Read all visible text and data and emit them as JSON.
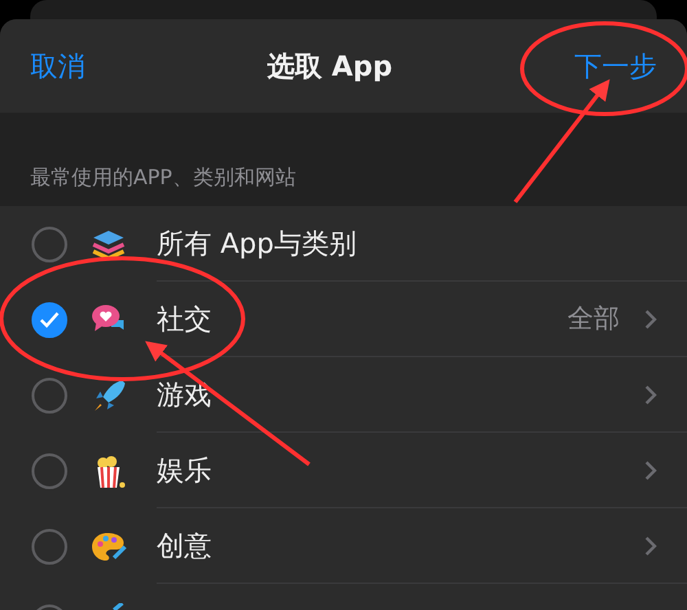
{
  "header": {
    "cancel": "取消",
    "title": "选取 App",
    "next": "下一步"
  },
  "section_title": "最常使用的APP、类别和网站",
  "rows": [
    {
      "kind": "layers",
      "label": "所有 App与类别",
      "checked": false,
      "chevron": false
    },
    {
      "kind": "chat",
      "label": "社交",
      "checked": true,
      "detail": "全部",
      "chevron": true
    },
    {
      "kind": "rocket",
      "label": "游戏",
      "checked": false,
      "chevron": true
    },
    {
      "kind": "popcorn",
      "label": "娱乐",
      "checked": false,
      "chevron": true
    },
    {
      "kind": "palette",
      "label": "创意",
      "checked": false,
      "chevron": true
    },
    {
      "kind": "partial",
      "checked": false,
      "chevron": false
    }
  ]
}
